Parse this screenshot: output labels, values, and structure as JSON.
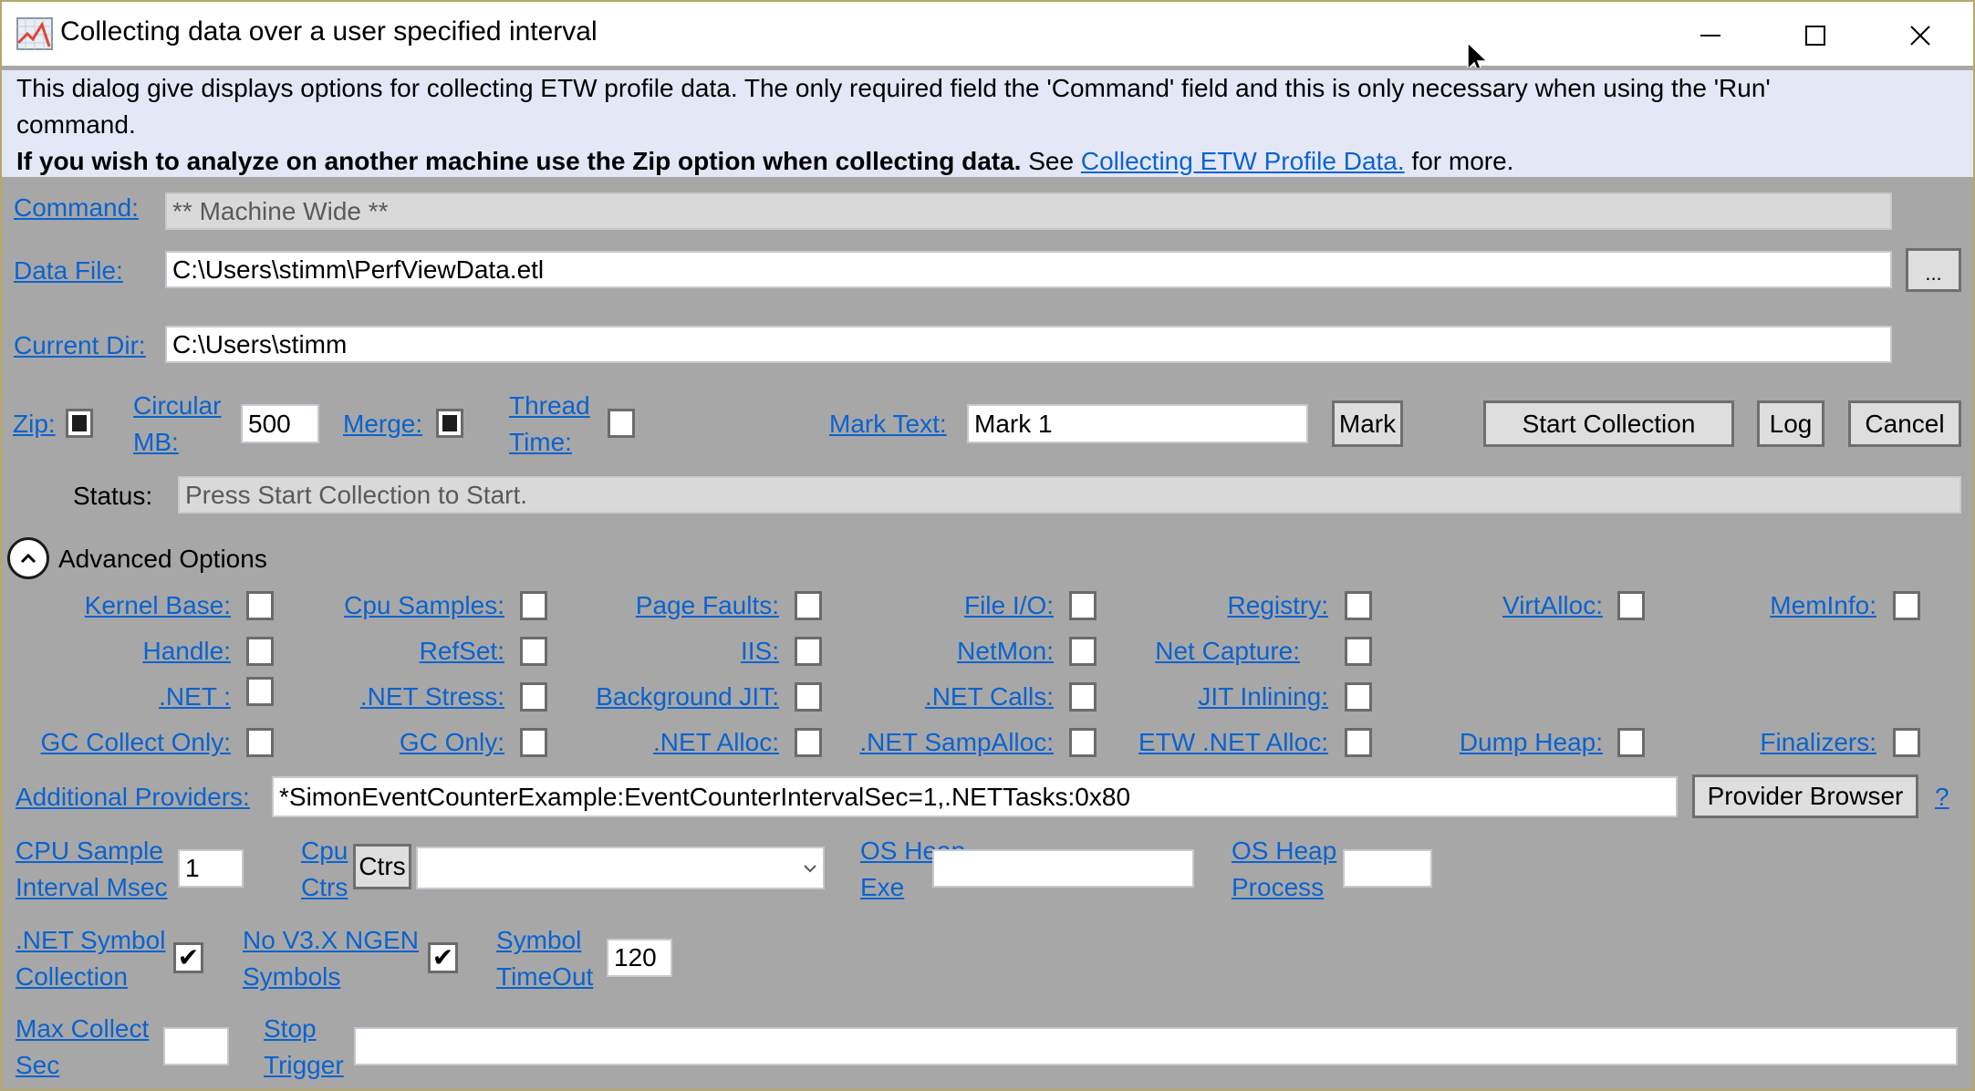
{
  "window": {
    "title": "Collecting data over a user specified interval",
    "app_icon": "chart-line-icon",
    "controls": {
      "minimize": "minimize-icon",
      "maximize": "maximize-icon",
      "close": "close-icon"
    }
  },
  "banner": {
    "line1": "This dialog give displays options for collecting ETW profile data. The only required field the 'Command' field and this is only necessary when using the 'Run'",
    "line2": "command.",
    "bold_text": "If you wish to analyze on another machine use the Zip option when collecting data.",
    "see_text": " See ",
    "link_text": "Collecting ETW Profile Data.",
    "after_link": " for more."
  },
  "fields": {
    "command": {
      "label": "Command:",
      "value": "** Machine Wide **"
    },
    "data_file": {
      "label": "Data File:",
      "value": "C:\\Users\\stimm\\PerfViewData.etl",
      "browse_label": "..."
    },
    "current_dir": {
      "label": "Current Dir:",
      "value": "C:\\Users\\stimm"
    }
  },
  "options_row": {
    "zip": {
      "label": "Zip:",
      "state": "indeterminate"
    },
    "circular_mb": {
      "label_line1": "Circular",
      "label_line2": "MB:",
      "value": "500"
    },
    "merge": {
      "label": "Merge:",
      "state": "indeterminate"
    },
    "thread_time": {
      "label_line1": "Thread",
      "label_line2": "Time:",
      "state": "unchecked"
    },
    "mark_text": {
      "label": "Mark Text:",
      "value": "Mark 1"
    },
    "mark_button": "Mark",
    "start_button": "Start Collection",
    "log_button": "Log",
    "cancel_button": "Cancel"
  },
  "status": {
    "label": "Status:",
    "value": "Press Start Collection to Start."
  },
  "advanced": {
    "title": "Advanced Options",
    "toggle_icon": "chevron-up-circle-icon",
    "grid": [
      [
        {
          "label": "Kernel Base:",
          "checked": false
        },
        {
          "label": "Cpu Samples:",
          "checked": false
        },
        {
          "label": "Page Faults:",
          "checked": false
        },
        {
          "label": "File I/O:",
          "checked": false
        },
        {
          "label": "Registry:",
          "checked": false
        },
        {
          "label": "VirtAlloc:",
          "checked": false
        },
        {
          "label": "MemInfo:",
          "checked": false
        }
      ],
      [
        {
          "label": "Handle:",
          "checked": false
        },
        {
          "label": "RefSet:",
          "checked": false
        },
        {
          "label": "IIS:",
          "checked": false
        },
        {
          "label": "NetMon:",
          "checked": false
        },
        {
          "label": "Net Capture:",
          "checked": false
        }
      ],
      [
        {
          "label": ".NET :",
          "checked": false
        },
        {
          "label": ".NET Stress:",
          "checked": false
        },
        {
          "label": "Background JIT:",
          "checked": false
        },
        {
          "label": ".NET Calls:",
          "checked": false
        },
        {
          "label": "JIT Inlining:",
          "checked": false
        }
      ],
      [
        {
          "label": "GC Collect Only:",
          "checked": false
        },
        {
          "label": "GC Only:",
          "checked": false
        },
        {
          "label": ".NET Alloc:",
          "checked": false
        },
        {
          "label": ".NET SampAlloc:",
          "checked": false
        },
        {
          "label": "ETW .NET Alloc:",
          "checked": false
        },
        {
          "label": "Dump Heap:",
          "checked": false
        },
        {
          "label": "Finalizers:",
          "checked": false
        }
      ]
    ],
    "additional_providers": {
      "label": "Additional Providers:",
      "value": "*SimonEventCounterExample:EventCounterIntervalSec=1,.NETTasks:0x80",
      "browser_button": "Provider Browser",
      "help_link": "?"
    },
    "cpu_sample": {
      "label_line1": "CPU Sample",
      "label_line2": "Interval Msec",
      "value": "1"
    },
    "cpu_ctrs": {
      "label_line1": "Cpu",
      "label_line2": "Ctrs",
      "button": "Ctrs",
      "selected": ""
    },
    "os_heap_exe": {
      "label_line1": "OS Heap",
      "label_line2": "Exe",
      "value": ""
    },
    "os_heap_process": {
      "label_line1": "OS Heap",
      "label_line2": "Process",
      "value": ""
    },
    "net_symbol": {
      "label_line1": ".NET Symbol",
      "label_line2": "Collection",
      "checked": true
    },
    "no_v3_ngen": {
      "label_line1": "No V3.X NGEN",
      "label_line2": "Symbols",
      "checked": true
    },
    "symbol_timeout": {
      "label_line1": "Symbol",
      "label_line2": "TimeOut",
      "value": "120"
    },
    "max_collect": {
      "label_line1": "Max Collect",
      "label_line2": "Sec",
      "value": ""
    },
    "stop_trigger": {
      "label_line1": "Stop",
      "label_line2": "Trigger",
      "value": ""
    }
  },
  "colors": {
    "link": "#0b63cf",
    "background": "#a7a7a7",
    "banner": "#e3e7f6"
  }
}
